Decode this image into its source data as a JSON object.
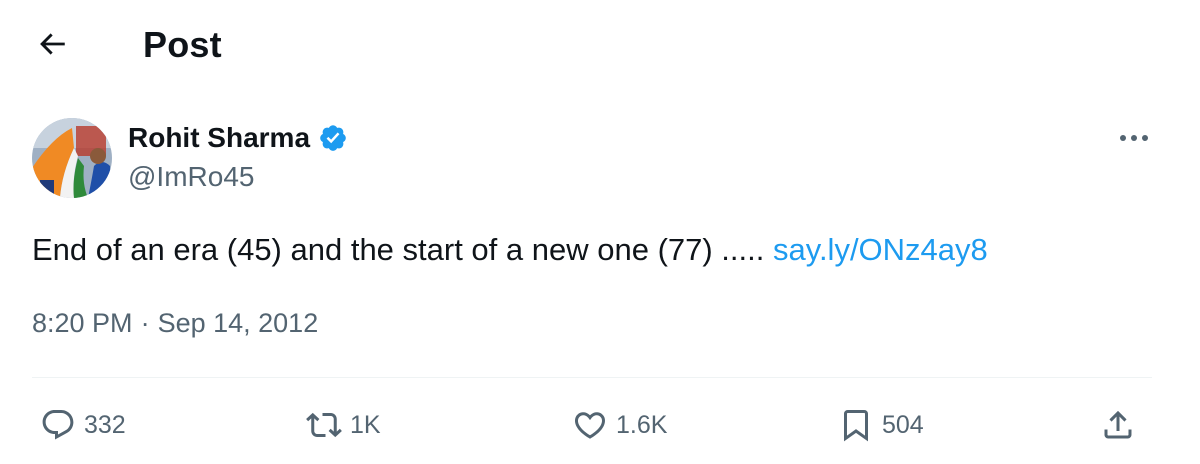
{
  "header": {
    "title": "Post",
    "back_icon": "arrow-left-icon"
  },
  "author": {
    "name": "Rohit Sharma",
    "handle": "@ImRo45",
    "verified": true,
    "verified_color": "#1d9bf0",
    "avatar": "profile-photo"
  },
  "post": {
    "text": "End of an era (45) and the start of a new one (77) .....",
    "link": "say.ly/ONz4ay8",
    "time": "8:20 PM",
    "separator": "·",
    "date": "Sep 14, 2012"
  },
  "actions": {
    "replies": "332",
    "reposts": "1K",
    "likes": "1.6K",
    "bookmarks": "504"
  },
  "colors": {
    "text": "#0f1419",
    "secondary": "#536471",
    "accent": "#1d9bf0",
    "divider": "#eff3f4"
  }
}
